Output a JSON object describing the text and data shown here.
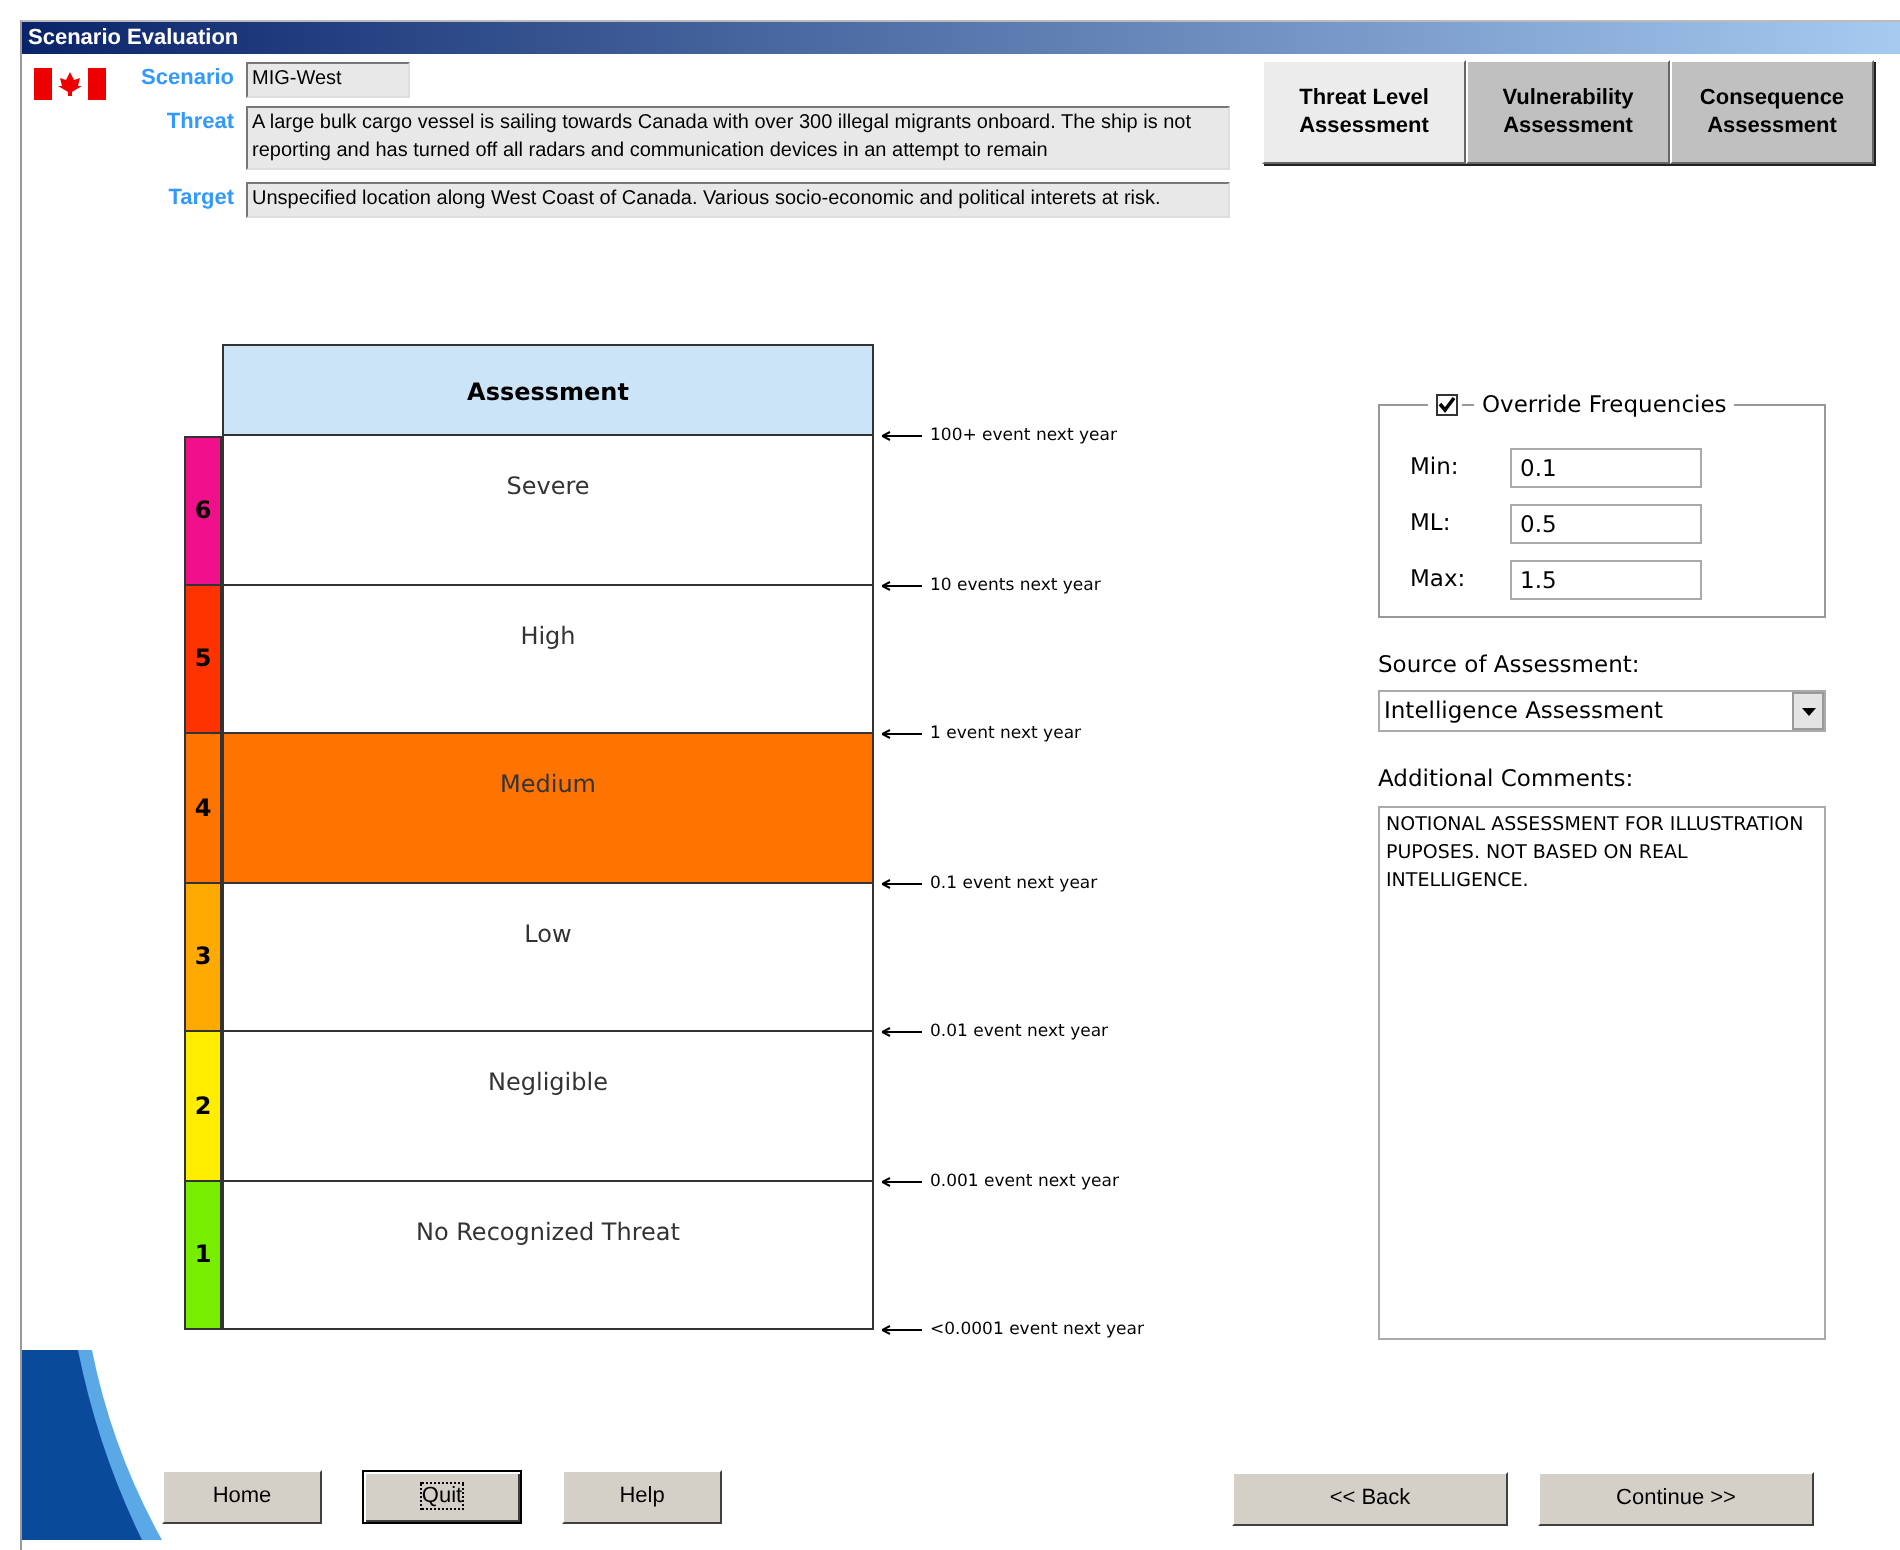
{
  "window": {
    "title": "Scenario Evaluation"
  },
  "scenario": {
    "fields": [
      {
        "label": "Scenario",
        "value": "MIG-West",
        "kind": "short"
      },
      {
        "label": "Threat",
        "value": "A large bulk cargo vessel is sailing towards Canada with over 300 illegal migrants onboard. The ship is not reporting and has turned off all radars and communication devices in an attempt to remain",
        "kind": "long"
      },
      {
        "label": "Target",
        "value": "Unspecified location along West Coast of Canada.  Various socio-economic and political interets at risk.",
        "kind": "wide"
      }
    ]
  },
  "tabs": [
    {
      "label": "Threat Level Assessment",
      "selected": true
    },
    {
      "label": "Vulnerability Assessment",
      "selected": false
    },
    {
      "label": "Consequence Assessment",
      "selected": false
    }
  ],
  "scale": {
    "heading": "Assessment",
    "levels": [
      {
        "number": "6",
        "label": "Severe",
        "color": "#f0108c",
        "selected": false
      },
      {
        "number": "5",
        "label": "High",
        "color": "#ff3300",
        "selected": false
      },
      {
        "number": "4",
        "label": "Medium",
        "color": "#ff7300",
        "selected": true
      },
      {
        "number": "3",
        "label": "Low",
        "color": "#ffaa00",
        "selected": false
      },
      {
        "number": "2",
        "label": "Negligible",
        "color": "#ffee00",
        "selected": false
      },
      {
        "number": "1",
        "label": "No Recognized Threat",
        "color": "#77ee00",
        "selected": false
      }
    ],
    "frequency_marks": [
      "100+ event next year",
      "10 events next year",
      "1 event next year",
      "0.1 event next year",
      "0.01 event next year",
      "0.001 event next year",
      "<0.0001 event next year"
    ]
  },
  "override": {
    "label": "Override Frequencies",
    "checked": true,
    "fields": [
      {
        "label": "Min:",
        "value": "0.1"
      },
      {
        "label": "ML:",
        "value": "0.5"
      },
      {
        "label": "Max:",
        "value": "1.5"
      }
    ]
  },
  "source": {
    "label": "Source of Assessment:",
    "value": "Intelligence Assessment"
  },
  "comments": {
    "label": "Additional Comments:",
    "value": "NOTIONAL ASSESSMENT FOR ILLUSTRATION PUPOSES.  NOT BASED ON REAL INTELLIGENCE."
  },
  "buttons_left": [
    {
      "label": "Home",
      "focused": false
    },
    {
      "label": "Quit",
      "focused": true
    },
    {
      "label": "Help",
      "focused": false
    }
  ],
  "buttons_right": [
    {
      "label": "<< Back",
      "focused": false
    },
    {
      "label": "Continue >>",
      "focused": false
    }
  ]
}
